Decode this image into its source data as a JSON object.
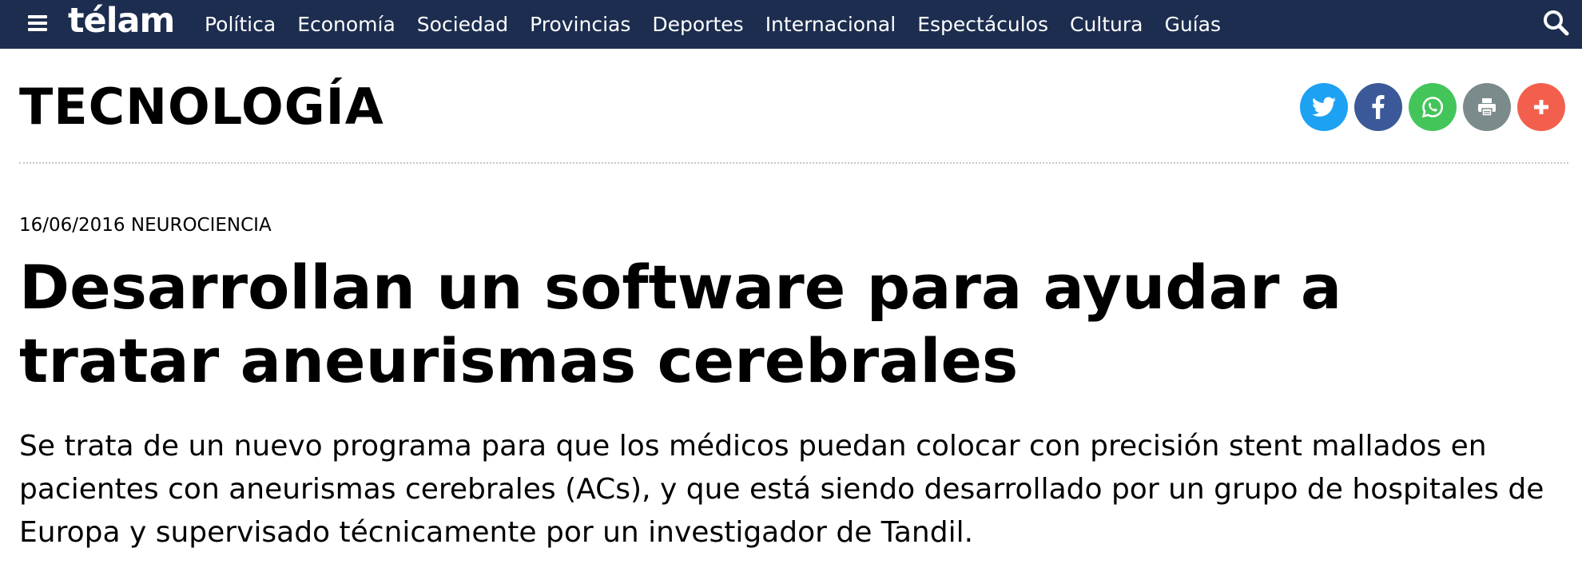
{
  "header": {
    "logo": "télam",
    "menu_icon": "hamburger-menu-icon",
    "search_icon": "search-icon",
    "nav": [
      "Política",
      "Economía",
      "Sociedad",
      "Provincias",
      "Deportes",
      "Internacional",
      "Espectáculos",
      "Cultura",
      "Guías"
    ],
    "background_color": "#1c2d4f"
  },
  "section": {
    "title": "TECNOLOGÍA"
  },
  "share": [
    {
      "icon": "twitter-icon",
      "color": "#1da1f2"
    },
    {
      "icon": "facebook-icon",
      "color": "#3b5998"
    },
    {
      "icon": "whatsapp-icon",
      "color": "#43c55a"
    },
    {
      "icon": "print-icon",
      "color": "#7b8a8b"
    },
    {
      "icon": "plus-icon",
      "color": "#f2604d"
    }
  ],
  "article": {
    "date": "16/06/2016",
    "category": "NEUROCIENCIA",
    "headline": "Desarrollan un software para ayudar a tratar aneurismas cerebrales",
    "summary": "Se trata de un nuevo programa para que los médicos puedan colocar con precisión stent mallados en pacientes con aneurismas cerebrales (ACs), y que está siendo desarrollado por un grupo de hospitales de Europa y supervisado técnicamente por un investigador de Tandil."
  }
}
